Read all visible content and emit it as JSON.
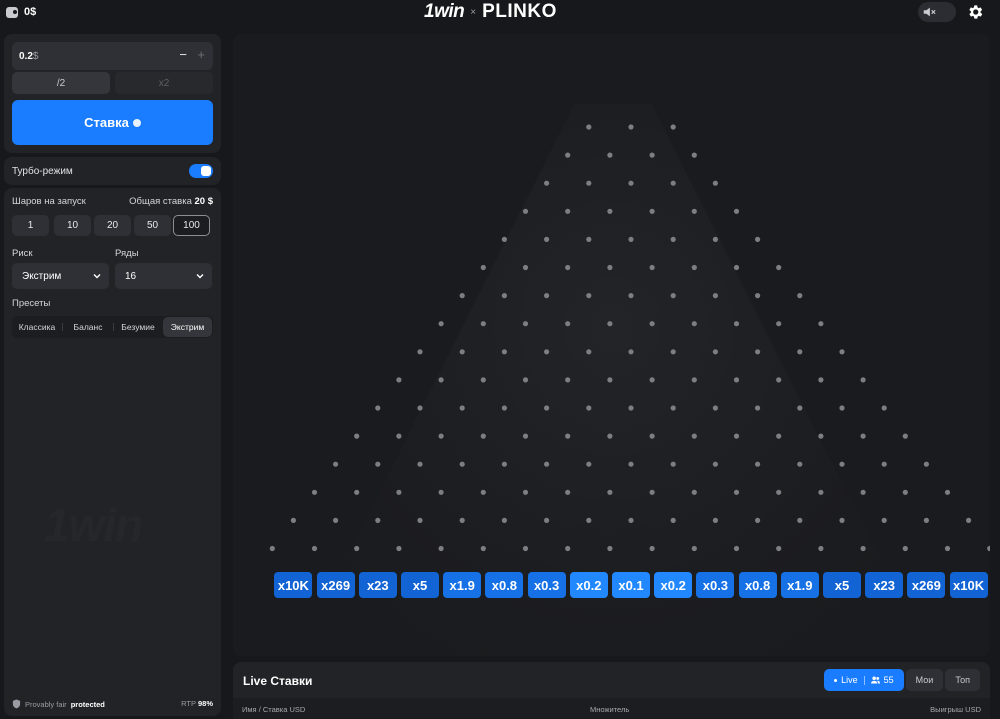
{
  "header": {
    "balance": "0$",
    "logo_brand": "1win",
    "logo_sep": "×",
    "logo_game": "PLINKO"
  },
  "bet": {
    "amount": "0.2",
    "currency": "$",
    "minus": "−",
    "plus": "+",
    "half_label": "/2",
    "double_label": "x2",
    "stake_label": "Ставка"
  },
  "turbo": {
    "label": "Турбо-режим",
    "enabled": true
  },
  "balls": {
    "label": "Шаров на запуск",
    "total_label": "Общая ставка",
    "total_value": "20 $",
    "options": [
      "1",
      "10",
      "20",
      "50",
      "100"
    ],
    "selected": "100"
  },
  "risk": {
    "label": "Риск",
    "value": "Экстрим"
  },
  "rows": {
    "label": "Ряды",
    "value": "16"
  },
  "presets": {
    "label": "Пресеты",
    "items": [
      "Классика",
      "Баланс",
      "Безумие",
      "Экстрим"
    ],
    "selected": "Экстрим"
  },
  "footer": {
    "fair_text": "Provably fair",
    "fair_status": "protected",
    "rtp_label": "RTP",
    "rtp_value": "98%"
  },
  "board": {
    "multipliers": [
      "x10K",
      "x269",
      "x23",
      "x5",
      "x1.9",
      "x0.8",
      "x0.3",
      "x0.2",
      "x0.1",
      "x0.2",
      "x0.3",
      "x0.8",
      "x1.9",
      "x5",
      "x23",
      "x269",
      "x10K"
    ],
    "colors": {
      "edge": "#1264d4",
      "mid": "#1670e6",
      "center": "#2288ff",
      "peg": "#7c7e84"
    }
  },
  "live_bets": {
    "title": "Live Ставки",
    "tab_live": "Live",
    "players": "55",
    "tab_mine": "Мои",
    "tab_top": "Топ",
    "columns": [
      "Имя / Ставка USD",
      "Множитель",
      "Выигрыш USD"
    ]
  },
  "accent": "#1a7cff"
}
